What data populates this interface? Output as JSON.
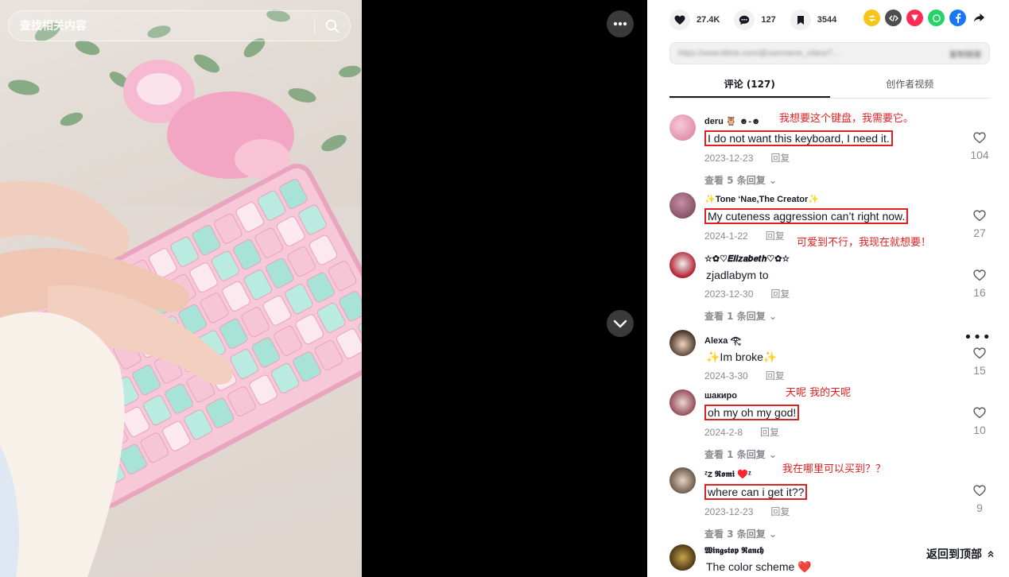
{
  "search": {
    "placeholder": "查找相关内容"
  },
  "stats": {
    "likes": "27.4K",
    "comments": "127",
    "saves": "3544"
  },
  "share_icons": [
    {
      "name": "repost-icon",
      "color": "#f5c518"
    },
    {
      "name": "embed-icon",
      "color": "#4d4d4d"
    },
    {
      "name": "send-icon",
      "color": "#fe2c55"
    },
    {
      "name": "whatsapp-icon",
      "color": "#25d366"
    },
    {
      "name": "facebook-icon",
      "color": "#1877f2"
    }
  ],
  "link": {
    "url": "https://www.tiktok.com/@username_video/7...",
    "copy_label": "复制链接"
  },
  "tabs": [
    {
      "label": "评论 (127)"
    },
    {
      "label": "创作者视频"
    }
  ],
  "comments": [
    {
      "user": "deru 🦉 ☻-☻",
      "text": "I do not want this keyboard, I need it.",
      "date": "2023-12-23",
      "reply": "回复",
      "likes": "104",
      "view_replies": "查看 5 条回复",
      "annotation": "我想要这个键盘，我需要它。",
      "boxed": true
    },
    {
      "user": "✨Tone ‘Nae,The Creator✨",
      "text": "My cuteness aggression can’t right now.",
      "date": "2024-1-22",
      "reply": "回复",
      "likes": "27",
      "annotation": "可爱到不行，我现在就想要！",
      "boxed": true
    },
    {
      "user": "☆✿♡𝑬𝒍𝒊𝒛𝒂𝒃𝒆𝒕𝒉♡✿☆",
      "text": "zjadlabym to",
      "date": "2023-12-30",
      "reply": "回复",
      "likes": "16",
      "view_replies": "查看 1 条回复",
      "boxed": false
    },
    {
      "user": "Alexa 𓂀",
      "text": "✨Im broke✨",
      "date": "2024-3-30",
      "reply": "回复",
      "likes": "15",
      "boxed": false
    },
    {
      "user": "шакиро",
      "text": "oh my oh my god!",
      "date": "2024-2-8",
      "reply": "回复",
      "likes": "10",
      "view_replies": "查看 1 条回复",
      "annotation": "天呢 我的天呢",
      "boxed": true
    },
    {
      "user": "ᶻ𝗓 𝕽𝖔𝖒𝖎 ♥️ᶻ",
      "text": "where can i get it??",
      "date": "2023-12-23",
      "reply": "回复",
      "likes": "9",
      "view_replies": "查看 3 条回复",
      "annotation": "我在哪里可以买到？？",
      "boxed": true
    },
    {
      "user": "𝖂𝖎𝖓𝖌𝖘𝖙𝖔𝖕 𝕽𝖆𝖓𝖈𝖍",
      "text": "The color scheme ❤️",
      "boxed": false
    }
  ],
  "back_to_top": "返回到顶部"
}
